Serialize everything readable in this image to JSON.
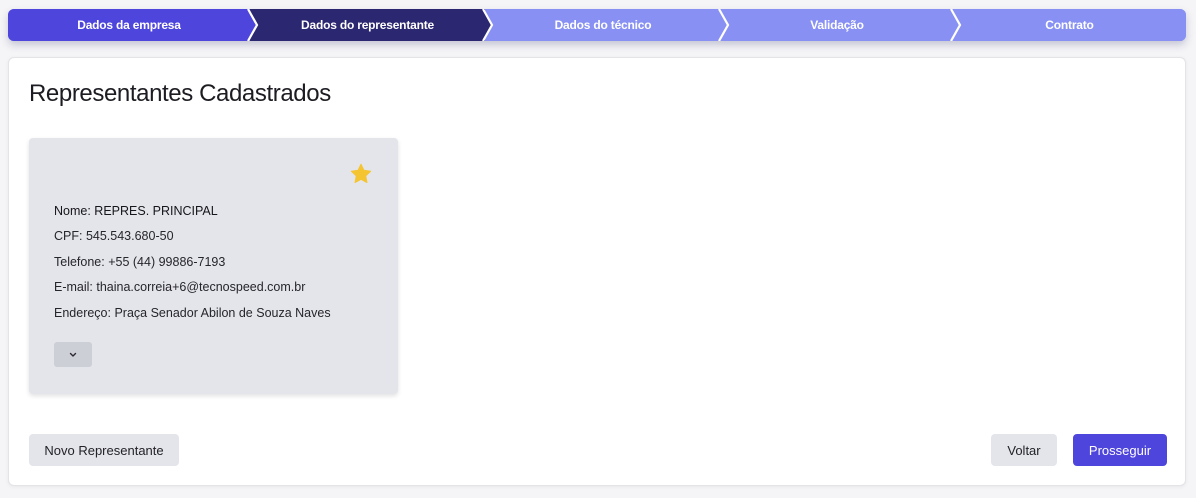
{
  "stepper": {
    "steps": [
      {
        "label": "Dados da empresa",
        "state": "done"
      },
      {
        "label": "Dados do representante",
        "state": "active"
      },
      {
        "label": "Dados do técnico",
        "state": "pending"
      },
      {
        "label": "Validação",
        "state": "pending"
      },
      {
        "label": "Contrato",
        "state": "pending"
      }
    ]
  },
  "page": {
    "title": "Representantes Cadastrados"
  },
  "representative_card": {
    "favorite_icon": "star-icon",
    "name_label": "Nome: ",
    "name_value": "REPRES. PRINCIPAL",
    "cpf_label": "CPF: ",
    "cpf_value": "545.543.680-50",
    "phone_label": "Telefone: ",
    "phone_value": "+55 (44) 99886-7193",
    "email_label": "E-mail: ",
    "email_value": "thaina.correia+6@tecnospeed.com.br",
    "address_label": "Endereço: ",
    "address_value": "Praça Senador Abilon de Souza Naves",
    "expand_icon": "chevron-down-icon"
  },
  "footer": {
    "new_label": "Novo Representante",
    "back_label": "Voltar",
    "next_label": "Prosseguir"
  },
  "colors": {
    "primary": "#4e45dc",
    "active_step": "#2c2771",
    "pending_step": "#8890f4",
    "star": "#f5c531",
    "card_bg": "#e4e5ea"
  }
}
